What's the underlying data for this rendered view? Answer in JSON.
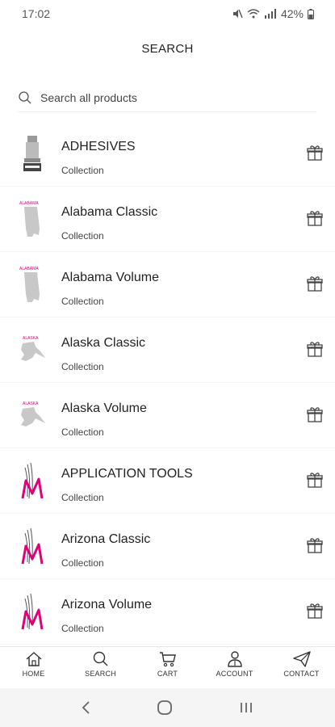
{
  "status_bar": {
    "time": "17:02",
    "battery": "42%"
  },
  "header": {
    "title": "SEARCH"
  },
  "search": {
    "placeholder": "Search all products"
  },
  "results": [
    {
      "name": "ADHESIVES",
      "type": "Collection",
      "thumb": "adhesive-bottle"
    },
    {
      "name": "Alabama Classic",
      "type": "Collection",
      "thumb": "alabama-map",
      "thumb_text": "ALABAMA"
    },
    {
      "name": "Alabama Volume",
      "type": "Collection",
      "thumb": "alabama-map",
      "thumb_text": "ALABAMA"
    },
    {
      "name": "Alaska Classic",
      "type": "Collection",
      "thumb": "alaska-map",
      "thumb_text": "ALASKA"
    },
    {
      "name": "Alaska Volume",
      "type": "Collection",
      "thumb": "alaska-map",
      "thumb_text": "ALASKA"
    },
    {
      "name": "APPLICATION TOOLS",
      "type": "Collection",
      "thumb": "brand-logo"
    },
    {
      "name": "Arizona Classic",
      "type": "Collection",
      "thumb": "brand-logo"
    },
    {
      "name": "Arizona Volume",
      "type": "Collection",
      "thumb": "brand-logo"
    }
  ],
  "bottom_nav": {
    "home": "HOME",
    "search": "SEARCH",
    "cart": "CART",
    "account": "ACCOUNT",
    "contact": "CONTACT"
  },
  "colors": {
    "brand_pink": "#e0007a",
    "thumb_gray": "#c8c8c8"
  }
}
